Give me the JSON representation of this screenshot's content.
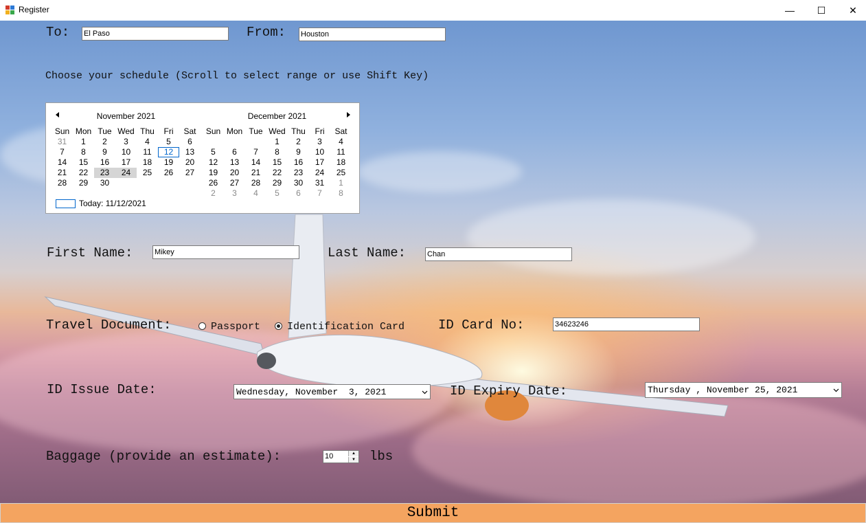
{
  "window": {
    "title": "Register",
    "minimize": "—",
    "maximize": "☐",
    "close": "✕"
  },
  "route": {
    "to_label": "To:",
    "to_value": "El Paso",
    "from_label": "From:",
    "from_value": "Houston"
  },
  "schedule_label": "Choose your schedule (Scroll to select range or use Shift Key)",
  "calendar": {
    "weekdays": [
      "Sun",
      "Mon",
      "Tue",
      "Wed",
      "Thu",
      "Fri",
      "Sat"
    ],
    "months": [
      {
        "title": "November 2021",
        "weeks": [
          [
            "31",
            "1",
            "2",
            "3",
            "4",
            "5",
            "6"
          ],
          [
            "7",
            "8",
            "9",
            "10",
            "11",
            "12",
            "13"
          ],
          [
            "14",
            "15",
            "16",
            "17",
            "18",
            "19",
            "20"
          ],
          [
            "21",
            "22",
            "23",
            "24",
            "25",
            "26",
            "27"
          ],
          [
            "28",
            "29",
            "30",
            "",
            "",
            "",
            ""
          ]
        ]
      },
      {
        "title": "December 2021",
        "weeks": [
          [
            "",
            "",
            "",
            "1",
            "2",
            "3",
            "4"
          ],
          [
            "5",
            "6",
            "7",
            "8",
            "9",
            "10",
            "11"
          ],
          [
            "12",
            "13",
            "14",
            "15",
            "16",
            "17",
            "18"
          ],
          [
            "19",
            "20",
            "21",
            "22",
            "23",
            "24",
            "25"
          ],
          [
            "26",
            "27",
            "28",
            "29",
            "30",
            "31",
            "1"
          ],
          [
            "2",
            "3",
            "4",
            "5",
            "6",
            "7",
            "8"
          ]
        ]
      }
    ],
    "selected_range": [
      "23",
      "24"
    ],
    "today_marked": "12",
    "today_text": "Today: 11/12/2021",
    "highlight_color": "#0066cc"
  },
  "name": {
    "first_label": "First Name:",
    "first_value": "Mikey",
    "last_label": "Last Name:",
    "last_value": "Chan"
  },
  "document": {
    "label": "Travel Document:",
    "options": [
      "Passport",
      "Identification Card"
    ],
    "selected": "Identification Card",
    "id_label": "ID Card No:",
    "id_value": "34623246"
  },
  "dates": {
    "issue_label": "ID Issue Date:",
    "issue_value": "Wednesday, November  3, 2021",
    "expiry_label": "ID Expiry Date:",
    "expiry_value": "Thursday , November 25, 2021"
  },
  "baggage": {
    "label": "Baggage (provide an estimate):",
    "value": "10",
    "unit": "lbs"
  },
  "submit_label": "Submit",
  "colors": {
    "submit": "#f4a460",
    "title_bar": "#ffffff"
  }
}
